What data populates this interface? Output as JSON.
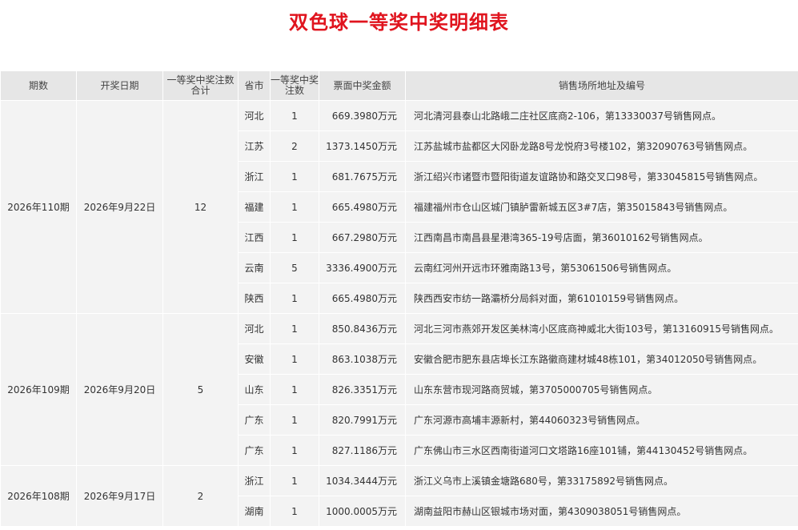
{
  "page": {
    "title": "双色球一等奖中奖明细表"
  },
  "table": {
    "headers": [
      "期数",
      "开奖日期",
      "一等奖中奖注数合计",
      "省市",
      "一等奖中奖注数",
      "票面中奖金额",
      "销售场所地址及编号"
    ],
    "draws": [
      {
        "issue": "2026年110期",
        "date": "2026年9月22日",
        "total": "12",
        "rows": [
          {
            "province": "河北",
            "count": "1",
            "amount": "669.3980万元",
            "address": "河北清河县泰山北路峨二庄社区底商2-106，第13330037号销售网点。"
          },
          {
            "province": "江苏",
            "count": "2",
            "amount": "1373.1450万元",
            "address": "江苏盐城市盐都区大冈卧龙路8号龙悦府3号楼102，第32090763号销售网点。"
          },
          {
            "province": "浙江",
            "count": "1",
            "amount": "681.7675万元",
            "address": "浙江绍兴市诸暨市暨阳街道友谊路协和路交叉口98号，第33045815号销售网点。"
          },
          {
            "province": "福建",
            "count": "1",
            "amount": "665.4980万元",
            "address": "福建福州市仓山区城门镇胪雷新城五区3#7店，第35015843号销售网点。"
          },
          {
            "province": "江西",
            "count": "1",
            "amount": "667.2980万元",
            "address": "江西南昌市南昌县星港湾365-19号店面，第36010162号销售网点。"
          },
          {
            "province": "云南",
            "count": "5",
            "amount": "3336.4900万元",
            "address": "云南红河州开远市环雅南路13号，第53061506号销售网点。"
          },
          {
            "province": "陕西",
            "count": "1",
            "amount": "665.4980万元",
            "address": "陕西西安市纺一路灞桥分局斜对面，第61010159号销售网点。"
          }
        ]
      },
      {
        "issue": "2026年109期",
        "date": "2026年9月20日",
        "total": "5",
        "rows": [
          {
            "province": "河北",
            "count": "1",
            "amount": "850.8436万元",
            "address": "河北三河市燕郊开发区美林湾小区底商神威北大街103号，第13160915号销售网点。"
          },
          {
            "province": "安徽",
            "count": "1",
            "amount": "863.1038万元",
            "address": "安徽合肥市肥东县店埠长江东路徽商建材城48栋101，第34012050号销售网点。"
          },
          {
            "province": "山东",
            "count": "1",
            "amount": "826.3351万元",
            "address": "山东东营市现河路商贸城，第3705000705号销售网点。"
          },
          {
            "province": "广东",
            "count": "1",
            "amount": "820.7991万元",
            "address": "广东河源市高埔丰源新村，第44060323号销售网点。"
          },
          {
            "province": "广东",
            "count": "1",
            "amount": "827.1186万元",
            "address": "广东佛山市三水区西南街道河口文塔路16座101铺，第44130452号销售网点。"
          }
        ]
      },
      {
        "issue": "2026年108期",
        "date": "2026年9月17日",
        "total": "2",
        "rows": [
          {
            "province": "浙江",
            "count": "1",
            "amount": "1034.3444万元",
            "address": "浙江义乌市上溪镇金塘路680号，第33175892号销售网点。"
          },
          {
            "province": "湖南",
            "count": "1",
            "amount": "1000.0005万元",
            "address": "湖南益阳市赫山区银城市场对面，第4309038051号销售网点。"
          }
        ]
      }
    ]
  }
}
